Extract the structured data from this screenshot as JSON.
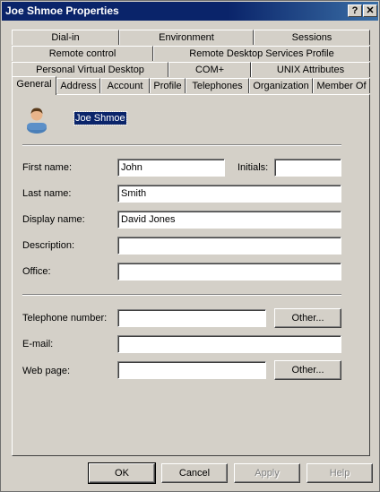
{
  "window": {
    "title": "Joe Shmoe Properties",
    "help_btn": "?",
    "close_btn": "✕"
  },
  "tabs": {
    "row1": [
      "Dial-in",
      "Environment",
      "Sessions"
    ],
    "row2": [
      "Remote control",
      "Remote Desktop Services Profile"
    ],
    "row3": [
      "Personal Virtual Desktop",
      "COM+",
      "UNIX Attributes"
    ],
    "row4": [
      "General",
      "Address",
      "Account",
      "Profile",
      "Telephones",
      "Organization",
      "Member Of"
    ]
  },
  "general": {
    "user_display": "Joe Shmoe",
    "first_name_label": "First name:",
    "first_name_value": "John",
    "initials_label": "Initials:",
    "initials_value": "",
    "last_name_label": "Last name:",
    "last_name_value": "Smith",
    "display_name_label": "Display name:",
    "display_name_value": "David Jones",
    "description_label": "Description:",
    "description_value": "",
    "office_label": "Office:",
    "office_value": "",
    "telephone_label": "Telephone number:",
    "telephone_value": "",
    "email_label": "E-mail:",
    "email_value": "",
    "webpage_label": "Web page:",
    "webpage_value": "",
    "other_label": "Other..."
  },
  "buttons": {
    "ok": "OK",
    "cancel": "Cancel",
    "apply": "Apply",
    "help": "Help"
  }
}
